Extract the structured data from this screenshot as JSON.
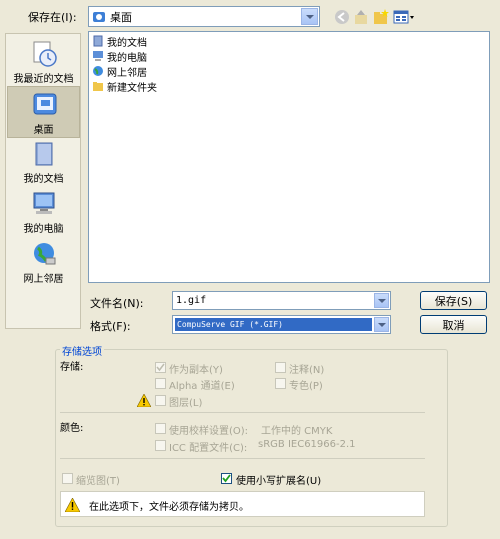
{
  "save_in": {
    "label": "保存在(I):",
    "value": "桌面"
  },
  "toolbar_icons": [
    "back-icon",
    "up-folder-icon",
    "new-folder-icon",
    "view-menu-icon"
  ],
  "places": [
    {
      "id": "recent",
      "label": "我最近的文档"
    },
    {
      "id": "desktop",
      "label": "桌面"
    },
    {
      "id": "mydocs",
      "label": "我的文档"
    },
    {
      "id": "mycomputer",
      "label": "我的电脑"
    },
    {
      "id": "network",
      "label": "网上邻居"
    }
  ],
  "files": [
    {
      "label": "我的文档"
    },
    {
      "label": "我的电脑"
    },
    {
      "label": "网上邻居"
    },
    {
      "label": "新建文件夹"
    }
  ],
  "filename": {
    "label": "文件名(N):",
    "value": "1.gif"
  },
  "format": {
    "label": "格式(F):",
    "value": "CompuServe GIF (*.GIF)"
  },
  "buttons": {
    "save": "保存(S)",
    "cancel": "取消"
  },
  "options": {
    "group_title": "存储选项",
    "save_label": "存储:",
    "as_copy": "作为副本(Y)",
    "notes": "注释(N)",
    "alpha": "Alpha 通道(E)",
    "spot": "专色(P)",
    "layers": "图层(L)",
    "color_label": "颜色:",
    "proof": "使用校样设置(O):",
    "proof_value": "工作中的 CMYK",
    "icc": "ICC 配置文件(C):",
    "icc_value": "sRGB IEC61966-2.1",
    "thumbnail": "缩览图(T)",
    "lowercase": "使用小写扩展名(U)",
    "lowercase_checked": true,
    "warning": "在此选项下，文件必须存储为拷贝。"
  }
}
